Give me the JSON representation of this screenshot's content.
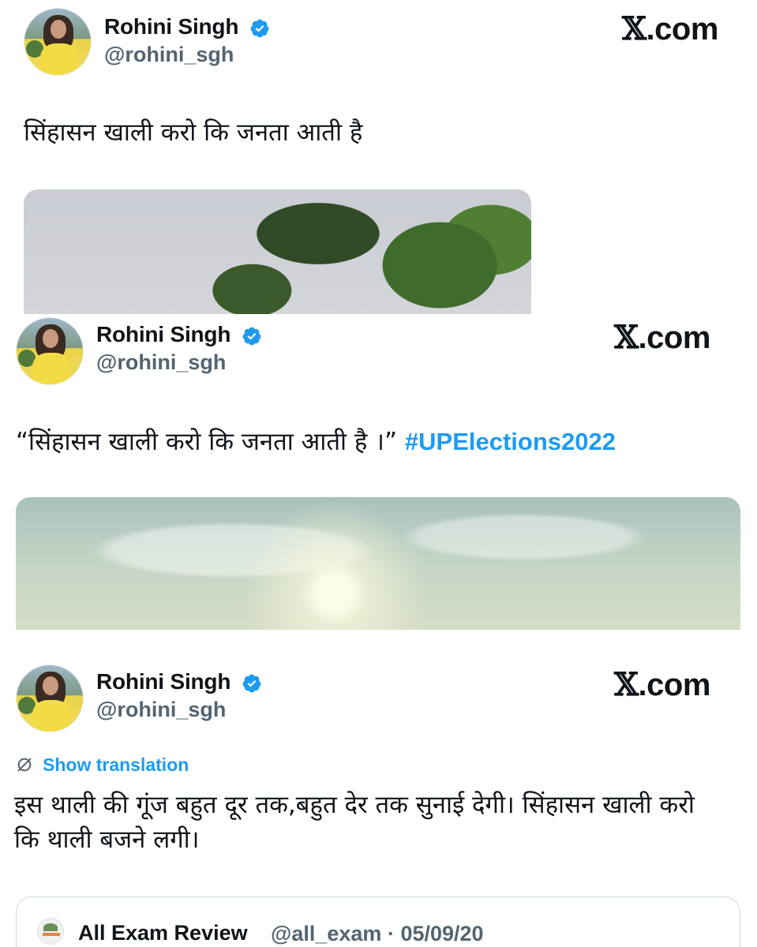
{
  "tweets": [
    {
      "author": {
        "name": "Rohini Singh",
        "handle": "@rohini_sgh",
        "verified": true
      },
      "brand": {
        "mark": "𝕏",
        "suffix": ".com"
      },
      "text": "सिंहासन खाली करो कि जनता आती है",
      "media": "trees-video-thumbnail"
    },
    {
      "author": {
        "name": "Rohini Singh",
        "handle": "@rohini_sgh",
        "verified": true
      },
      "brand": {
        "mark": "𝕏",
        "suffix": ".com"
      },
      "text": "“सिंहासन खाली करो कि जनता आती है ।”",
      "hashtag": "#UPElections2022",
      "media": "sky-sun-video-thumbnail"
    },
    {
      "author": {
        "name": "Rohini Singh",
        "handle": "@rohini_sgh",
        "verified": true
      },
      "brand": {
        "mark": "𝕏",
        "suffix": ".com"
      },
      "translate_label": "Show translation",
      "text_line1": "इस थाली की गूंज बहुत दूर तक,बहुत देर तक सुनाई देगी।  सिंहासन खाली करो",
      "text_line2": "कि थाली बजने लगी।",
      "quoted": {
        "name": "All Exam Review",
        "handle": "@all_exam",
        "separator": "·",
        "date": "05/09/20"
      }
    }
  ],
  "colors": {
    "link_blue": "#1d9bf0",
    "verified_blue": "#1d9bf0",
    "muted_text": "#536471",
    "primary_text": "#0f1419"
  },
  "icons": [
    "verified-badge-icon",
    "translate-icon"
  ]
}
